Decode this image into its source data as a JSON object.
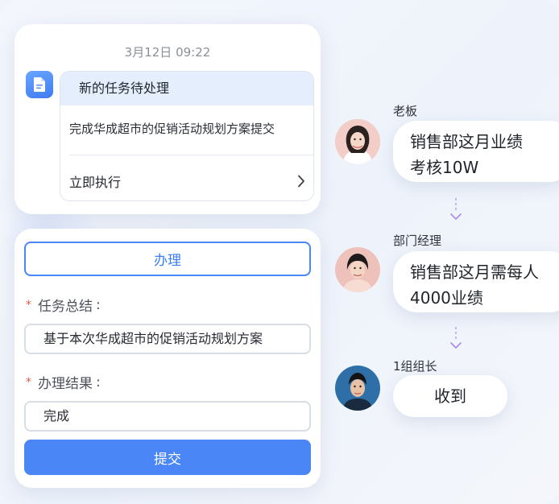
{
  "task_card": {
    "timestamp": "3月12日 09:22",
    "icon": "document-icon",
    "header": "新的任务待处理",
    "description": "完成华成超市的促销活动规划方案提交",
    "action_label": "立即执行",
    "action_icon": "chevron-right-icon"
  },
  "form": {
    "handle_label": "办理",
    "summary_label": "任务总结",
    "summary_value": "基于本次华成超市的促销活动规划方案",
    "result_label": "办理结果",
    "result_value": "完成",
    "required_mark": "*",
    "colon": ":",
    "submit_label": "提交"
  },
  "flow": [
    {
      "role": "老板",
      "message_line1": "销售部这月业绩",
      "message_line2": "考核10W"
    },
    {
      "role": "部门经理",
      "message_line1": "销售部这月需每人",
      "message_line2": "4000业绩"
    },
    {
      "role": "1组组长",
      "message_line1": "收到",
      "message_line2": ""
    }
  ],
  "colors": {
    "accent": "#4a86f5",
    "header_bg": "#e4eefc",
    "required": "#e45b4d",
    "arrow": "#a98ae6"
  }
}
